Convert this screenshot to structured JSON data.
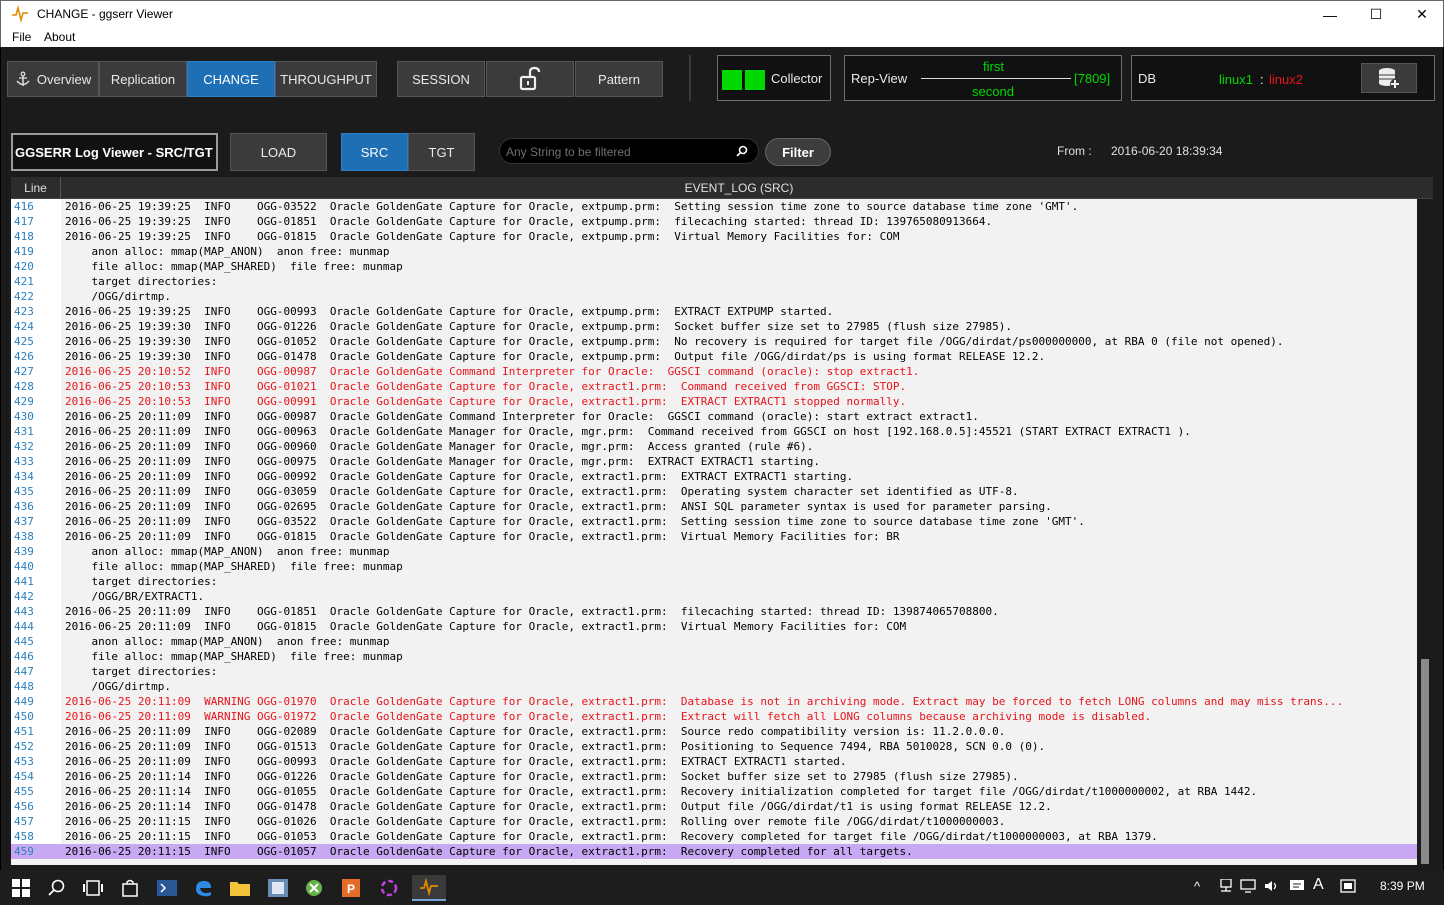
{
  "window": {
    "title": "CHANGE - ggserr Viewer",
    "controls": [
      "—",
      "☐",
      "✕"
    ]
  },
  "menu": {
    "items": [
      "File",
      "About"
    ]
  },
  "nav": {
    "tabs": [
      "Overview",
      "Replication",
      "CHANGE",
      "THROUGHPUT"
    ],
    "session": "SESSION",
    "pattern": "Pattern"
  },
  "collector": {
    "label": "Collector",
    "status_color": "#00d800"
  },
  "repview": {
    "label": "Rep-View",
    "first": "first",
    "second": "second",
    "port": "[7809]"
  },
  "db": {
    "label": "DB",
    "host1": "linux1",
    "sep": ":",
    "host2": "linux2"
  },
  "toolbar": {
    "title": "GGSERR Log Viewer - SRC/TGT",
    "load": "LOAD",
    "src": "SRC",
    "tgt": "TGT",
    "search_placeholder": "Any String to be filtered",
    "filter": "Filter",
    "from_label": "From :",
    "from_value": "2016-06-20 18:39:34"
  },
  "table": {
    "col_line": "Line",
    "col_log": "EVENT_LOG (SRC)",
    "rows": [
      {
        "n": "416",
        "t": "2016-06-25 19:39:25  INFO    OGG-03522  Oracle GoldenGate Capture for Oracle, extpump.prm:  Setting session time zone to source database time zone 'GMT'.",
        "s": ""
      },
      {
        "n": "417",
        "t": "2016-06-25 19:39:25  INFO    OGG-01851  Oracle GoldenGate Capture for Oracle, extpump.prm:  filecaching started: thread ID: 139765080913664.",
        "s": ""
      },
      {
        "n": "418",
        "t": "2016-06-25 19:39:25  INFO    OGG-01815  Oracle GoldenGate Capture for Oracle, extpump.prm:  Virtual Memory Facilities for: COM",
        "s": ""
      },
      {
        "n": "419",
        "t": "    anon alloc: mmap(MAP_ANON)  anon free: munmap",
        "s": ""
      },
      {
        "n": "420",
        "t": "    file alloc: mmap(MAP_SHARED)  file free: munmap",
        "s": ""
      },
      {
        "n": "421",
        "t": "    target directories:",
        "s": ""
      },
      {
        "n": "422",
        "t": "    /OGG/dirtmp.",
        "s": ""
      },
      {
        "n": "423",
        "t": "2016-06-25 19:39:25  INFO    OGG-00993  Oracle GoldenGate Capture for Oracle, extpump.prm:  EXTRACT EXTPUMP started.",
        "s": ""
      },
      {
        "n": "424",
        "t": "2016-06-25 19:39:30  INFO    OGG-01226  Oracle GoldenGate Capture for Oracle, extpump.prm:  Socket buffer size set to 27985 (flush size 27985).",
        "s": ""
      },
      {
        "n": "425",
        "t": "2016-06-25 19:39:30  INFO    OGG-01052  Oracle GoldenGate Capture for Oracle, extpump.prm:  No recovery is required for target file /OGG/dirdat/ps000000000, at RBA 0 (file not opened).",
        "s": ""
      },
      {
        "n": "426",
        "t": "2016-06-25 19:39:30  INFO    OGG-01478  Oracle GoldenGate Capture for Oracle, extpump.prm:  Output file /OGG/dirdat/ps is using format RELEASE 12.2.",
        "s": ""
      },
      {
        "n": "427",
        "t": "2016-06-25 20:10:52  INFO    OGG-00987  Oracle GoldenGate Command Interpreter for Oracle:  GGSCI command (oracle): stop extract1.",
        "s": "red"
      },
      {
        "n": "428",
        "t": "2016-06-25 20:10:53  INFO    OGG-01021  Oracle GoldenGate Capture for Oracle, extract1.prm:  Command received from GGSCI: STOP.",
        "s": "red"
      },
      {
        "n": "429",
        "t": "2016-06-25 20:10:53  INFO    OGG-00991  Oracle GoldenGate Capture for Oracle, extract1.prm:  EXTRACT EXTRACT1 stopped normally.",
        "s": "red"
      },
      {
        "n": "430",
        "t": "2016-06-25 20:11:09  INFO    OGG-00987  Oracle GoldenGate Command Interpreter for Oracle:  GGSCI command (oracle): start extract extract1.",
        "s": ""
      },
      {
        "n": "431",
        "t": "2016-06-25 20:11:09  INFO    OGG-00963  Oracle GoldenGate Manager for Oracle, mgr.prm:  Command received from GGSCI on host [192.168.0.5]:45521 (START EXTRACT EXTRACT1 ).",
        "s": ""
      },
      {
        "n": "432",
        "t": "2016-06-25 20:11:09  INFO    OGG-00960  Oracle GoldenGate Manager for Oracle, mgr.prm:  Access granted (rule #6).",
        "s": ""
      },
      {
        "n": "433",
        "t": "2016-06-25 20:11:09  INFO    OGG-00975  Oracle GoldenGate Manager for Oracle, mgr.prm:  EXTRACT EXTRACT1 starting.",
        "s": ""
      },
      {
        "n": "434",
        "t": "2016-06-25 20:11:09  INFO    OGG-00992  Oracle GoldenGate Capture for Oracle, extract1.prm:  EXTRACT EXTRACT1 starting.",
        "s": ""
      },
      {
        "n": "435",
        "t": "2016-06-25 20:11:09  INFO    OGG-03059  Oracle GoldenGate Capture for Oracle, extract1.prm:  Operating system character set identified as UTF-8.",
        "s": ""
      },
      {
        "n": "436",
        "t": "2016-06-25 20:11:09  INFO    OGG-02695  Oracle GoldenGate Capture for Oracle, extract1.prm:  ANSI SQL parameter syntax is used for parameter parsing.",
        "s": ""
      },
      {
        "n": "437",
        "t": "2016-06-25 20:11:09  INFO    OGG-03522  Oracle GoldenGate Capture for Oracle, extract1.prm:  Setting session time zone to source database time zone 'GMT'.",
        "s": ""
      },
      {
        "n": "438",
        "t": "2016-06-25 20:11:09  INFO    OGG-01815  Oracle GoldenGate Capture for Oracle, extract1.prm:  Virtual Memory Facilities for: BR",
        "s": ""
      },
      {
        "n": "439",
        "t": "    anon alloc: mmap(MAP_ANON)  anon free: munmap",
        "s": ""
      },
      {
        "n": "440",
        "t": "    file alloc: mmap(MAP_SHARED)  file free: munmap",
        "s": ""
      },
      {
        "n": "441",
        "t": "    target directories:",
        "s": ""
      },
      {
        "n": "442",
        "t": "    /OGG/BR/EXTRACT1.",
        "s": ""
      },
      {
        "n": "443",
        "t": "2016-06-25 20:11:09  INFO    OGG-01851  Oracle GoldenGate Capture for Oracle, extract1.prm:  filecaching started: thread ID: 139874065708800.",
        "s": ""
      },
      {
        "n": "444",
        "t": "2016-06-25 20:11:09  INFO    OGG-01815  Oracle GoldenGate Capture for Oracle, extract1.prm:  Virtual Memory Facilities for: COM",
        "s": ""
      },
      {
        "n": "445",
        "t": "    anon alloc: mmap(MAP_ANON)  anon free: munmap",
        "s": ""
      },
      {
        "n": "446",
        "t": "    file alloc: mmap(MAP_SHARED)  file free: munmap",
        "s": ""
      },
      {
        "n": "447",
        "t": "    target directories:",
        "s": ""
      },
      {
        "n": "448",
        "t": "    /OGG/dirtmp.",
        "s": ""
      },
      {
        "n": "449",
        "t": "2016-06-25 20:11:09  WARNING OGG-01970  Oracle GoldenGate Capture for Oracle, extract1.prm:  Database is not in archiving mode. Extract may be forced to fetch LONG columns and may miss trans...",
        "s": "red"
      },
      {
        "n": "450",
        "t": "2016-06-25 20:11:09  WARNING OGG-01972  Oracle GoldenGate Capture for Oracle, extract1.prm:  Extract will fetch all LONG columns because archiving mode is disabled.",
        "s": "red"
      },
      {
        "n": "451",
        "t": "2016-06-25 20:11:09  INFO    OGG-02089  Oracle GoldenGate Capture for Oracle, extract1.prm:  Source redo compatibility version is: 11.2.0.0.0.",
        "s": ""
      },
      {
        "n": "452",
        "t": "2016-06-25 20:11:09  INFO    OGG-01513  Oracle GoldenGate Capture for Oracle, extract1.prm:  Positioning to Sequence 7494, RBA 5010028, SCN 0.0 (0).",
        "s": ""
      },
      {
        "n": "453",
        "t": "2016-06-25 20:11:09  INFO    OGG-00993  Oracle GoldenGate Capture for Oracle, extract1.prm:  EXTRACT EXTRACT1 started.",
        "s": ""
      },
      {
        "n": "454",
        "t": "2016-06-25 20:11:14  INFO    OGG-01226  Oracle GoldenGate Capture for Oracle, extract1.prm:  Socket buffer size set to 27985 (flush size 27985).",
        "s": ""
      },
      {
        "n": "455",
        "t": "2016-06-25 20:11:14  INFO    OGG-01055  Oracle GoldenGate Capture for Oracle, extract1.prm:  Recovery initialization completed for target file /OGG/dirdat/t1000000002, at RBA 1442.",
        "s": ""
      },
      {
        "n": "456",
        "t": "2016-06-25 20:11:14  INFO    OGG-01478  Oracle GoldenGate Capture for Oracle, extract1.prm:  Output file /OGG/dirdat/t1 is using format RELEASE 12.2.",
        "s": ""
      },
      {
        "n": "457",
        "t": "2016-06-25 20:11:15  INFO    OGG-01026  Oracle GoldenGate Capture for Oracle, extract1.prm:  Rolling over remote file /OGG/dirdat/t1000000003.",
        "s": ""
      },
      {
        "n": "458",
        "t": "2016-06-25 20:11:15  INFO    OGG-01053  Oracle GoldenGate Capture for Oracle, extract1.prm:  Recovery completed for target file /OGG/dirdat/t1000000003, at RBA 1379.",
        "s": ""
      },
      {
        "n": "459",
        "t": "2016-06-25 20:11:15  INFO    OGG-01057  Oracle GoldenGate Capture for Oracle, extract1.prm:  Recovery completed for all targets.",
        "s": "sel"
      }
    ]
  },
  "taskbar": {
    "time": "8:39 PM",
    "icons": [
      "start-icon",
      "search-icon",
      "task-view-icon",
      "store-icon",
      "powershell-icon",
      "edge-icon",
      "file-explorer-icon",
      "app-icon",
      "excel-icon",
      "powerpoint-icon",
      "app-icon-2",
      "ggserr-viewer-icon"
    ]
  }
}
